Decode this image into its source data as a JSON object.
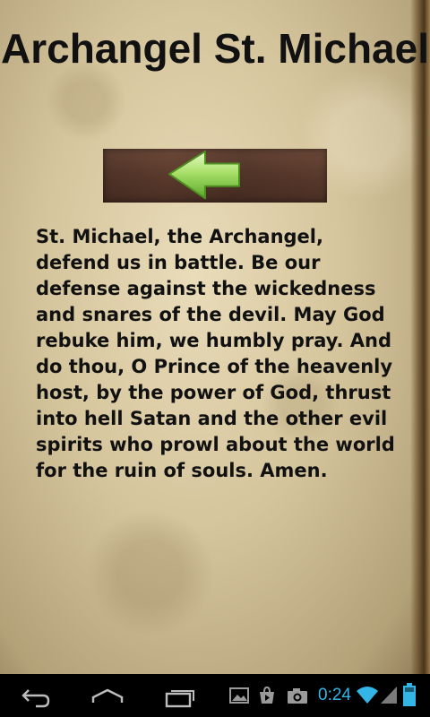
{
  "title": "Archangel St. Michael",
  "back_button": {
    "icon": "left-arrow-icon"
  },
  "prayer_text": "St. Michael, the Archangel, defend us in battle. Be our defense against the wickedness and snares of the devil. May God rebuke him, we humbly pray. And do thou, O Prince of the heavenly host, by the power of God, thrust into hell Satan and the other evil spirits who prowl about the world for the ruin of souls. Amen.",
  "navbar": {
    "back_icon": "back-icon",
    "home_icon": "home-icon",
    "recents_icon": "recent-apps-icon"
  },
  "status": {
    "time": "0:24",
    "icons": [
      "gallery-icon",
      "play-store-icon",
      "camera-icon",
      "wifi-icon",
      "signal-icon",
      "battery-icon"
    ],
    "accent_color": "#33b5e5"
  }
}
